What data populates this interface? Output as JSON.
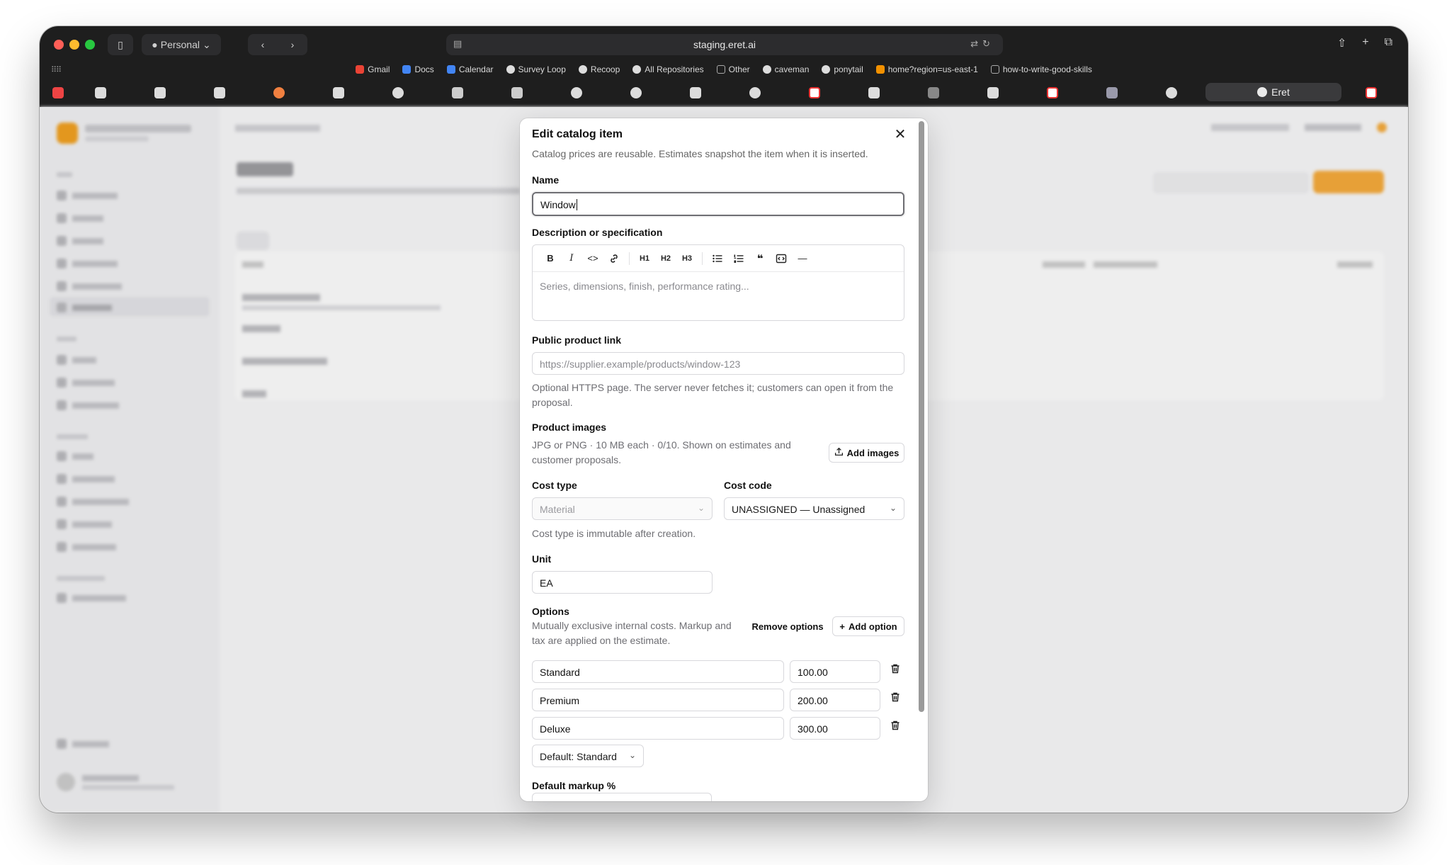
{
  "browser": {
    "profile_label": "Personal",
    "address": "staging.eret.ai",
    "active_tab_label": "Eret",
    "bookmarks": [
      "Gmail",
      "Docs",
      "Calendar",
      "Survey Loop",
      "Recoop",
      "All Repositories",
      "Other",
      "caveman",
      "ponytail",
      "home?region=us-east-1",
      "how-to-write-good-skills"
    ]
  },
  "modal": {
    "title": "Edit catalog item",
    "description": "Catalog prices are reusable. Estimates snapshot the item when it is inserted.",
    "name": {
      "label": "Name",
      "value": "Window"
    },
    "description_field": {
      "label": "Description or specification",
      "placeholder": "Series, dimensions, finish, performance rating...",
      "toolbar": [
        "bold",
        "italic",
        "code",
        "link",
        "h1",
        "h2",
        "h3",
        "bullet-list",
        "numbered-list",
        "quote",
        "code-block",
        "horizontal-rule"
      ],
      "toolbar_labels": {
        "bold": "B",
        "italic": "I",
        "code": "<>",
        "h1": "H1",
        "h2": "H2",
        "h3": "H3",
        "hr": "—"
      }
    },
    "product_link": {
      "label": "Public product link",
      "placeholder": "https://supplier.example/products/window-123",
      "help": "Optional HTTPS page. The server never fetches it; customers can open it from the proposal."
    },
    "product_images": {
      "label": "Product images",
      "help": "JPG or PNG · 10 MB each · 0/10. Shown on estimates and customer proposals.",
      "add_button": "Add images"
    },
    "cost_type": {
      "label": "Cost type",
      "value": "Material",
      "help": "Cost type is immutable after creation."
    },
    "cost_code": {
      "label": "Cost code",
      "value": "UNASSIGNED — Unassigned"
    },
    "unit": {
      "label": "Unit",
      "value": "EA"
    },
    "options": {
      "label": "Options",
      "help": "Mutually exclusive internal costs. Markup and tax are applied on the estimate.",
      "remove_button": "Remove options",
      "add_button": "Add option",
      "rows": [
        {
          "name": "Standard",
          "cost": "100.00"
        },
        {
          "name": "Premium",
          "cost": "200.00"
        },
        {
          "name": "Deluxe",
          "cost": "300.00"
        }
      ],
      "default_label": "Default: Standard"
    },
    "default_markup": {
      "label": "Default markup %"
    }
  },
  "colors": {
    "accent": "#f4a93a",
    "scrollbar": "#9a9a9a"
  }
}
